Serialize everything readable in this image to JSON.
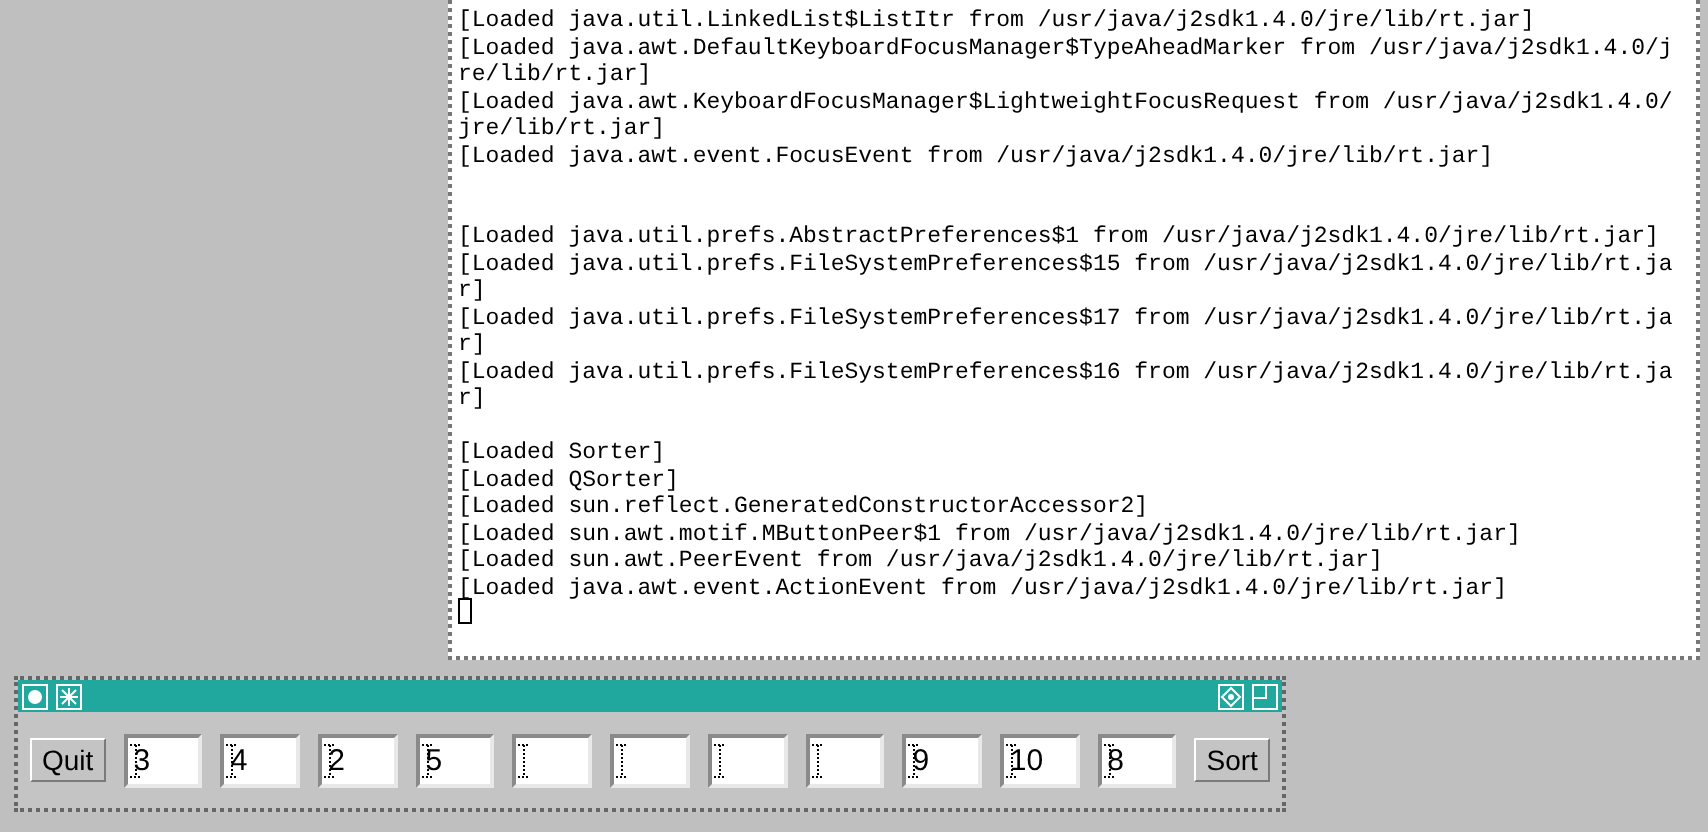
{
  "console": {
    "lines": [
      {
        "kind": "text",
        "text": "[Loaded java.util.LinkedList$ListItr from /usr/java/j2sdk1.4.0/jre/lib/rt.jar]"
      },
      {
        "kind": "text",
        "text": "[Loaded java.awt.DefaultKeyboardFocusManager$TypeAheadMarker from /usr/java/j2sdk1.4.0/j"
      },
      {
        "kind": "text",
        "text": "re/lib/rt.jar]"
      },
      {
        "kind": "text",
        "text": "[Loaded java.awt.KeyboardFocusManager$LightweightFocusRequest from /usr/java/j2sdk1.4.0/"
      },
      {
        "kind": "text",
        "text": "jre/lib/rt.jar]"
      },
      {
        "kind": "text",
        "text": "[Loaded java.awt.event.FocusEvent from /usr/java/j2sdk1.4.0/jre/lib/rt.jar]"
      },
      {
        "kind": "blank"
      },
      {
        "kind": "blank"
      },
      {
        "kind": "text",
        "text": "[Loaded java.util.prefs.AbstractPreferences$1 from /usr/java/j2sdk1.4.0/jre/lib/rt.jar]"
      },
      {
        "kind": "text",
        "text": "[Loaded java.util.prefs.FileSystemPreferences$15 from /usr/java/j2sdk1.4.0/jre/lib/rt.ja"
      },
      {
        "kind": "text",
        "text": "r]"
      },
      {
        "kind": "text",
        "text": "[Loaded java.util.prefs.FileSystemPreferences$17 from /usr/java/j2sdk1.4.0/jre/lib/rt.ja"
      },
      {
        "kind": "text",
        "text": "r]"
      },
      {
        "kind": "text",
        "text": "[Loaded java.util.prefs.FileSystemPreferences$16 from /usr/java/j2sdk1.4.0/jre/lib/rt.ja"
      },
      {
        "kind": "text",
        "text": "r]"
      },
      {
        "kind": "blank"
      },
      {
        "kind": "text",
        "text": "[Loaded Sorter]"
      },
      {
        "kind": "text",
        "text": "[Loaded QSorter]"
      },
      {
        "kind": "text",
        "text": "[Loaded sun.reflect.GeneratedConstructorAccessor2]"
      },
      {
        "kind": "text",
        "text": "[Loaded sun.awt.motif.MButtonPeer$1 from /usr/java/j2sdk1.4.0/jre/lib/rt.jar]"
      },
      {
        "kind": "text",
        "text": "[Loaded sun.awt.PeerEvent from /usr/java/j2sdk1.4.0/jre/lib/rt.jar]"
      },
      {
        "kind": "text",
        "text": "[Loaded java.awt.event.ActionEvent from /usr/java/j2sdk1.4.0/jre/lib/rt.jar]"
      },
      {
        "kind": "cursor"
      }
    ]
  },
  "sorter_window": {
    "controls": [
      {
        "kind": "button",
        "label": "Quit"
      },
      {
        "kind": "field",
        "value": "3"
      },
      {
        "kind": "field",
        "value": "4"
      },
      {
        "kind": "field",
        "value": "2"
      },
      {
        "kind": "field",
        "value": "5"
      },
      {
        "kind": "field"
      },
      {
        "kind": "field"
      },
      {
        "kind": "field"
      },
      {
        "kind": "field"
      },
      {
        "kind": "field",
        "value": "9"
      },
      {
        "kind": "field",
        "value": "10"
      },
      {
        "kind": "field",
        "value": "8"
      },
      {
        "kind": "button",
        "label": "Sort"
      }
    ]
  }
}
